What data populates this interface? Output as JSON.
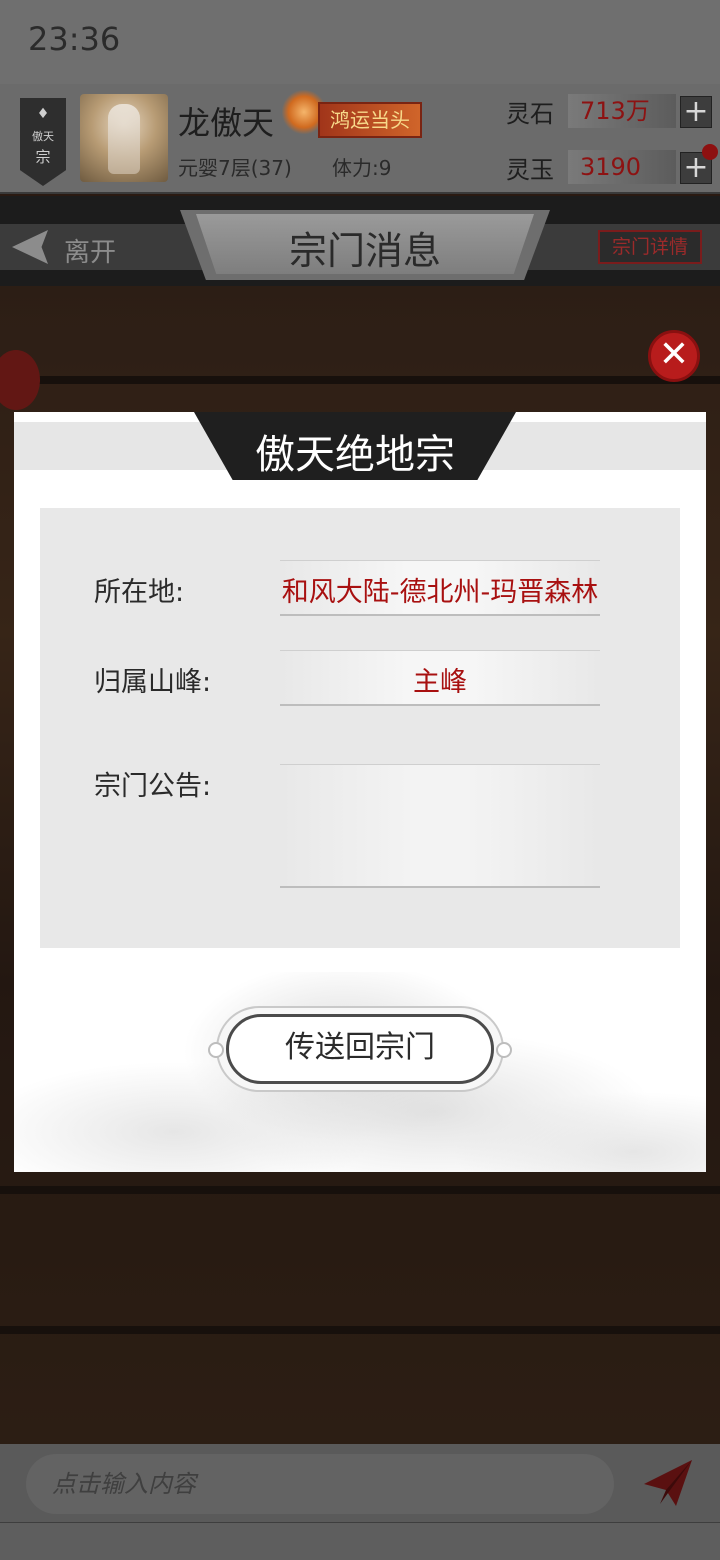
{
  "status_bar": {
    "time": "23:36"
  },
  "player": {
    "sect_emblem": {
      "name": "傲天",
      "label": "宗"
    },
    "name": "龙傲天",
    "title_badge": "鸿运当头",
    "level": "元婴7层(37)",
    "stamina": "体力:9"
  },
  "currencies": [
    {
      "label": "灵石",
      "value": "713万"
    },
    {
      "label": "灵玉",
      "value": "3190"
    }
  ],
  "nav": {
    "leave_label": "离开",
    "title": "宗门消息",
    "detail_button": "宗门详情"
  },
  "modal": {
    "title": "傲天绝地宗",
    "close_symbol": "✕",
    "rows": [
      {
        "label": "所在地:",
        "value": "和风大陆-德北州-玛晋森林"
      },
      {
        "label": "归属山峰:",
        "value": "主峰"
      },
      {
        "label": "宗门公告:",
        "value": ""
      }
    ],
    "teleport_button": "传送回宗门"
  },
  "chat": {
    "placeholder": "点击输入内容"
  },
  "colors": {
    "accent_red": "#a81010",
    "panel_gray": "#e8e8e8",
    "header_gray": "#6b6b6b"
  },
  "icons": {
    "close": "close-icon",
    "plus": "plus-icon",
    "send": "paper-plane-icon",
    "leave": "back-arrow-icon"
  }
}
